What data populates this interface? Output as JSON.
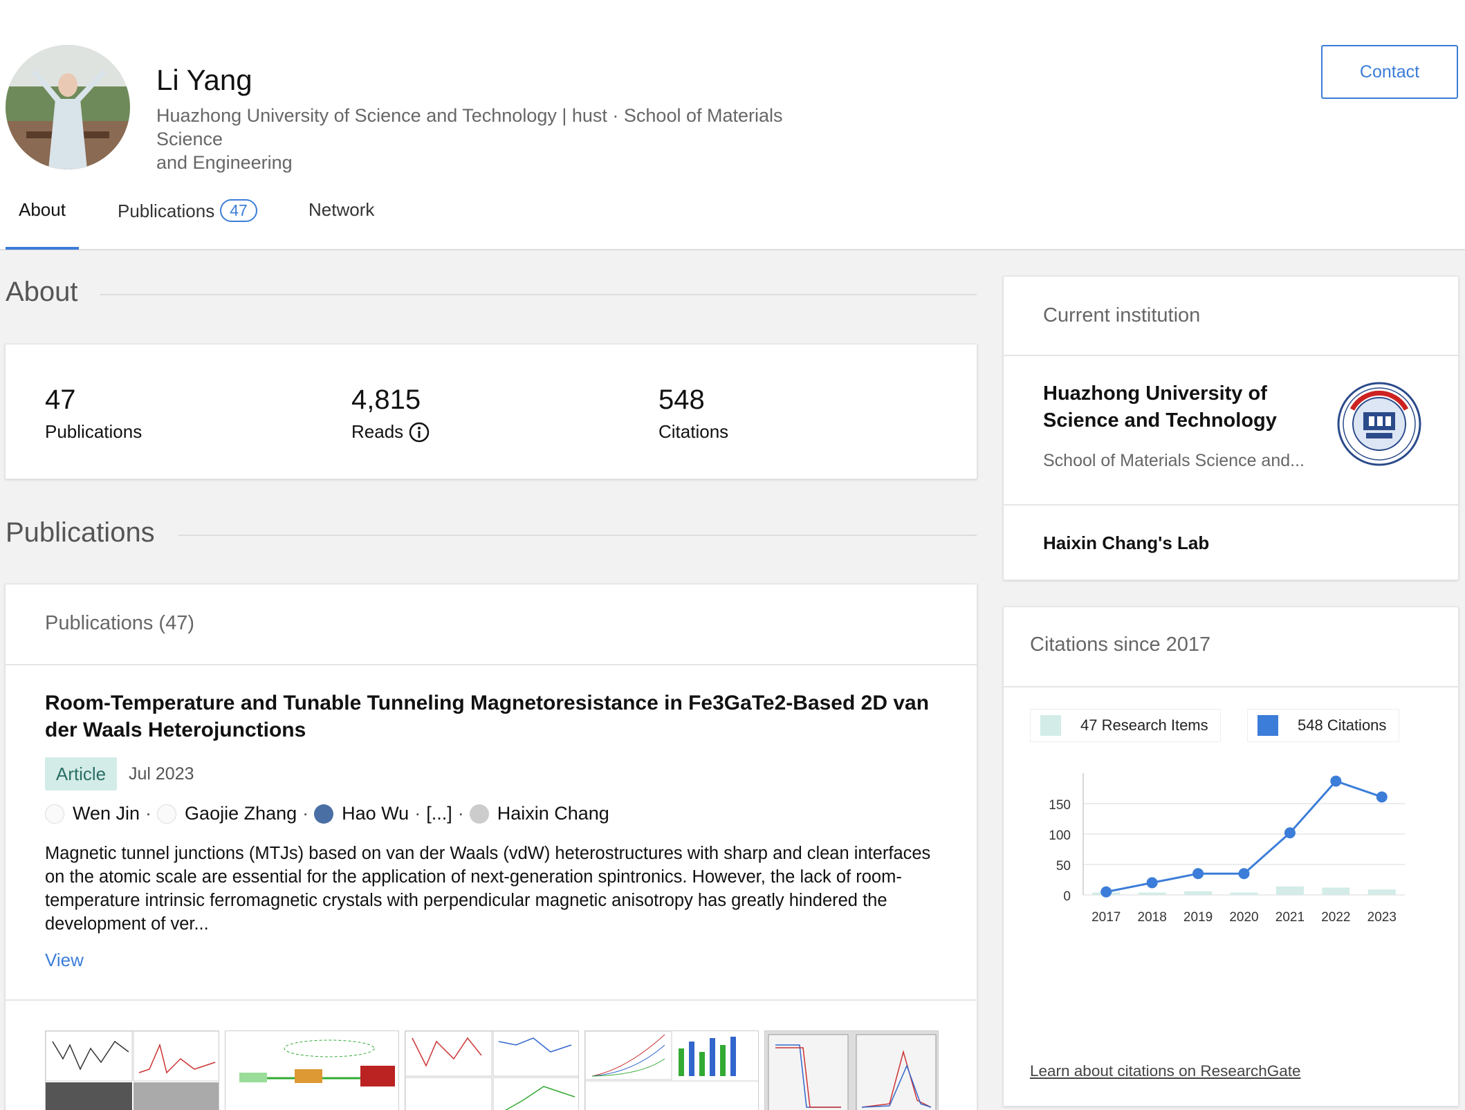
{
  "profile": {
    "name": "Li Yang",
    "affiliation_line1": "Huazhong University of Science and Technology | hust · School of Materials Science",
    "affiliation_line2": "and Engineering",
    "contact_label": "Contact"
  },
  "tabs": {
    "about": "About",
    "publications": "Publications",
    "publications_count": "47",
    "network": "Network"
  },
  "about": {
    "title": "About",
    "stats": [
      {
        "value": "47",
        "label": "Publications"
      },
      {
        "value": "4,815",
        "label": "Reads"
      },
      {
        "value": "548",
        "label": "Citations"
      }
    ]
  },
  "publications": {
    "section_title": "Publications",
    "card_header": "Publications (47)",
    "item": {
      "title": "Room-Temperature and Tunable Tunneling Magnetoresistance in Fe3GaTe2-Based 2D van der Waals Heterojunctions",
      "type": "Article",
      "date": "Jul 2023",
      "authors": [
        "Wen Jin",
        "Gaojie Zhang",
        "Hao Wu",
        "[...]",
        "Haixin Chang"
      ],
      "abstract": "Magnetic tunnel junctions (MTJs) based on van der Waals (vdW) heterostructures with sharp and clean interfaces on the atomic scale are essential for the application of next-generation spintronics. However, the lack of room-temperature intrinsic ferromagnetic crystals with perpendicular magnetic anisotropy has greatly hindered the development of ver...",
      "view_label": "View"
    }
  },
  "institution": {
    "label": "Current institution",
    "name": "Huazhong University of Science and Technology",
    "department": "School of Materials Science and...",
    "lab": "Haixin Chang's Lab"
  },
  "citations": {
    "title": "Citations since 2017",
    "legend_items": "47 Research Items",
    "legend_citations": "548 Citations",
    "learn_link": "Learn about citations on ResearchGate"
  },
  "chart_data": {
    "type": "line",
    "x": [
      "2017",
      "2018",
      "2019",
      "2020",
      "2021",
      "2022",
      "2023"
    ],
    "ylim": [
      0,
      200
    ],
    "yticks": [
      0,
      50,
      100,
      150
    ],
    "series": [
      {
        "name": "548 Citations",
        "kind": "line",
        "color": "#3b7dd8",
        "values": [
          5,
          20,
          35,
          35,
          102,
          187,
          161
        ]
      },
      {
        "name": "47 Research Items",
        "kind": "bar",
        "color": "#d3ece8",
        "values": [
          4,
          4,
          6,
          4,
          14,
          12,
          9
        ]
      }
    ]
  }
}
